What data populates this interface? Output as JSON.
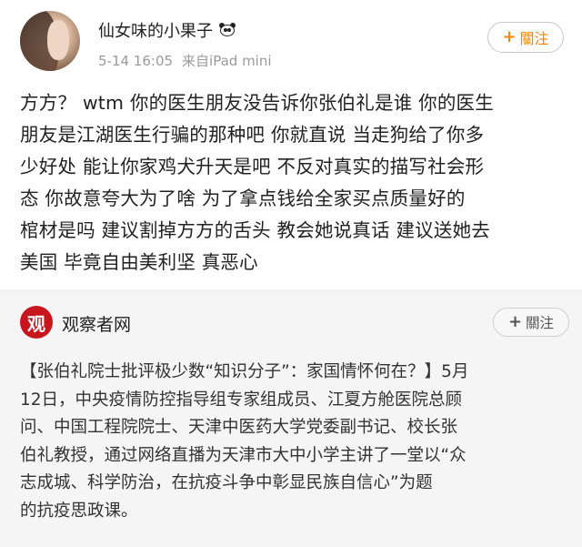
{
  "post": {
    "username": "仙女味的小果子",
    "date": "5-14 16:05",
    "source": "来自iPad mini",
    "follow_label": "關注",
    "follow_icon": "plus-icon",
    "badge_icon": "panda-icon",
    "lines": [
      "方方？ wtm 你的医生朋友没告诉你张伯礼是谁 你的医生",
      "朋友是江湖医生行骗的那种吧 你就直说 当走狗给了你多",
      "少好处 能让你家鸡犬升天是吧 不反对真实的描写社会形",
      "态 你故意夸大为了啥 为了拿点钱给全家买点质量好的",
      "棺材是吗 建议割掉方方的舌头 教会她说真话 建议送她去",
      "美国 毕竟自由美利坚 真恶心"
    ]
  },
  "repost": {
    "source_name": "观察者网",
    "source_logo_char": "观",
    "follow_label": "關注",
    "follow_icon": "plus-icon",
    "lines": [
      "【张伯礼院士批评极少数“知识分子”：家国情怀何在？】5月",
      "12日，中央疫情防控指导组专家组成员、江夏方舱医院总顾",
      "问、中国工程院院士、天津中医药大学党委副书记、校长张",
      "伯礼教授，通过网络直播为天津市大中小学主讲了一堂以“众",
      "志成城、科学防治，在抗疫斗争中彰显民族自信心”为题",
      "的抗疫思政课。"
    ]
  },
  "colors": {
    "accent": "#ff8200",
    "repost_bg": "#f5f5f5",
    "brand_red": "#c7161d"
  }
}
